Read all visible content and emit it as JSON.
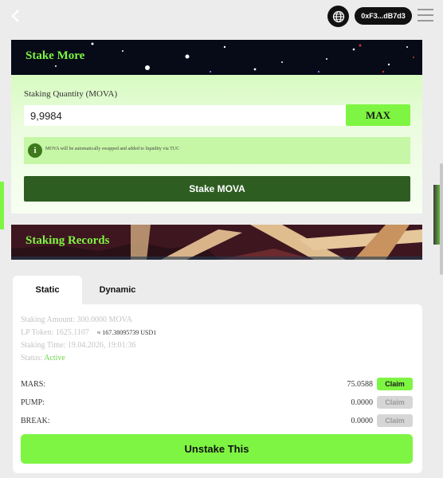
{
  "header": {
    "wallet_address": "0xF3...dB7d3"
  },
  "stake_more": {
    "title": "Stake More",
    "quantity_label": "Staking Quantity (MOVA)",
    "quantity_value": "9,9984",
    "max_label": "MAX",
    "info_text": "MOVA will be automatically swapped and added to liquidity via TUC",
    "submit_label": "Stake MOVA"
  },
  "records": {
    "title": "Staking Records",
    "tabs": [
      {
        "label": "Static",
        "active": true
      },
      {
        "label": "Dynamic",
        "active": false
      }
    ],
    "record": {
      "staking_amount": "Staking Amount: 300.0000 MOVA",
      "lp_token": "LP Token: 1625.1107",
      "lp_token_usd": "≈ 167.38095739 USD1",
      "staking_time": "Staking Time: 19.04.2026, 19:01:36",
      "status_label": "Status:",
      "status_value": "Active",
      "tokens": [
        {
          "name": "MARS:",
          "value": "75.0588",
          "claim_label": "Claim",
          "claim_enabled": true
        },
        {
          "name": "PUMP:",
          "value": "0.0000",
          "claim_label": "Claim",
          "claim_enabled": false
        },
        {
          "name": "BREAK:",
          "value": "0.0000",
          "claim_label": "Claim",
          "claim_enabled": false
        }
      ],
      "unstake_label": "Unstake This"
    }
  },
  "colors": {
    "accent": "#7ef542",
    "dark_green": "#2e5d22",
    "status_active": "#6ed94b"
  }
}
